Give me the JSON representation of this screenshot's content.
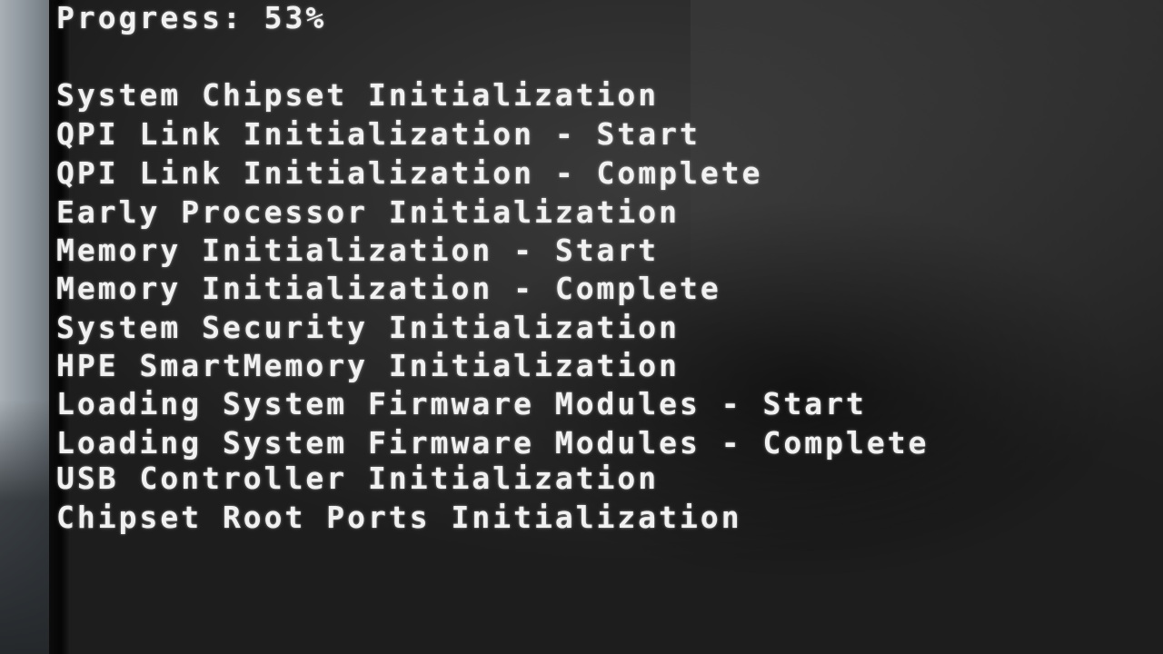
{
  "progress_line": {
    "text": "Progress: 53%",
    "value_percent": 53
  },
  "boot_messages": [
    "System Chipset Initialization",
    "QPI Link Initialization - Start",
    "QPI Link Initialization - Complete",
    "Early Processor Initialization",
    "Memory Initialization - Start",
    "Memory Initialization - Complete",
    "System Security Initialization",
    "HPE SmartMemory Initialization",
    "Loading System Firmware Modules - Start",
    "Loading System Firmware Modules - Complete",
    "USB Controller Initialization",
    "Chipset Root Ports Initialization"
  ],
  "colors": {
    "text": "#f1f1f1",
    "screen_background": "#2b2b2b",
    "bezel": "#8d969c"
  }
}
